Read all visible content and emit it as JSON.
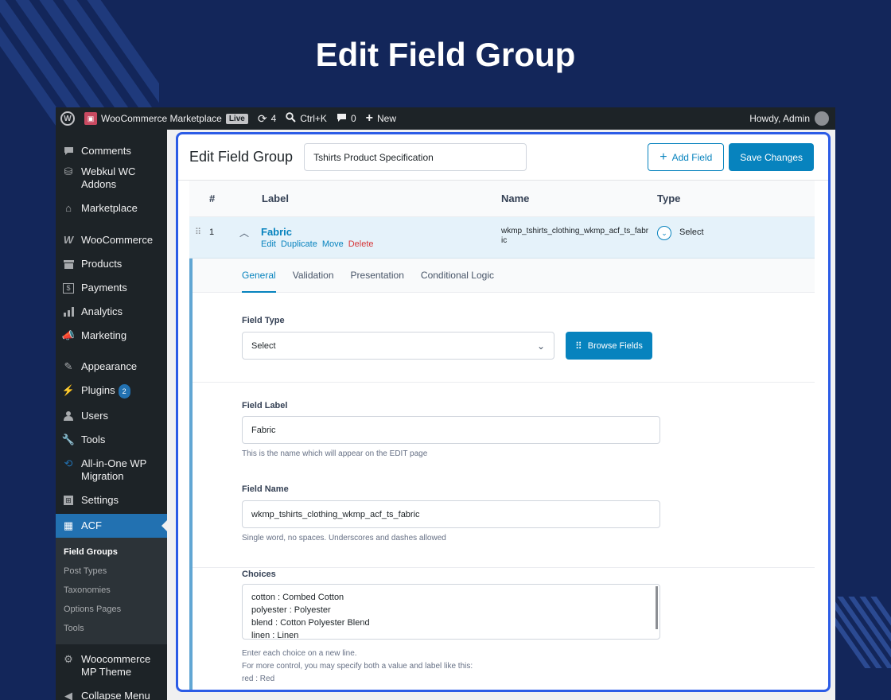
{
  "hero": {
    "title": "Edit Field Group"
  },
  "adminbar": {
    "site_name": "WooCommerce Marketplace",
    "live_badge": "Live",
    "updates_count": "4",
    "search_shortcut": "Ctrl+K",
    "comments_count": "0",
    "new_label": "New",
    "greeting": "Howdy, Admin"
  },
  "sidebar": {
    "items": [
      {
        "label": "Comments",
        "icon": "comment-icon"
      },
      {
        "label": "Webkul WC Addons",
        "icon": "webkul-icon"
      },
      {
        "label": "Marketplace",
        "icon": "store-icon"
      },
      {
        "label": "WooCommerce",
        "icon": "woocommerce-icon"
      },
      {
        "label": "Products",
        "icon": "archive-icon"
      },
      {
        "label": "Payments",
        "icon": "dollar-icon"
      },
      {
        "label": "Analytics",
        "icon": "chart-icon"
      },
      {
        "label": "Marketing",
        "icon": "megaphone-icon"
      },
      {
        "label": "Appearance",
        "icon": "brush-icon"
      },
      {
        "label": "Plugins",
        "icon": "plug-icon",
        "badge": "2"
      },
      {
        "label": "Users",
        "icon": "user-icon"
      },
      {
        "label": "Tools",
        "icon": "wrench-icon"
      },
      {
        "label": "All-in-One WP Migration",
        "icon": "migration-icon"
      },
      {
        "label": "Settings",
        "icon": "settings-icon"
      },
      {
        "label": "ACF",
        "icon": "acf-icon"
      }
    ],
    "submenu": [
      "Field Groups",
      "Post Types",
      "Taxonomies",
      "Options Pages",
      "Tools"
    ],
    "bottom_items": [
      {
        "label": "Woocommerce MP Theme",
        "icon": "gear-icon"
      },
      {
        "label": "Collapse Menu",
        "icon": "collapse-icon"
      }
    ]
  },
  "panel": {
    "title": "Edit Field Group",
    "group_name": "Tshirts Product Specification",
    "add_field": "Add Field",
    "save": "Save Changes"
  },
  "table": {
    "headers": {
      "order": "#",
      "label": "Label",
      "name": "Name",
      "type": "Type"
    },
    "row": {
      "order": "1",
      "label": "Fabric",
      "actions": {
        "edit": "Edit",
        "duplicate": "Duplicate",
        "move": "Move",
        "delete": "Delete"
      },
      "name_line1": "wkmp_tshirts_clothing_wkmp_acf_ts_fabr",
      "name_line2": "ic",
      "type": "Select"
    }
  },
  "tabs": [
    "General",
    "Validation",
    "Presentation",
    "Conditional Logic"
  ],
  "field_type": {
    "label": "Field Type",
    "value": "Select",
    "browse": "Browse Fields"
  },
  "field_label": {
    "label": "Field Label",
    "value": "Fabric",
    "help": "This is the name which will appear on the EDIT page"
  },
  "field_name": {
    "label": "Field Name",
    "value": "wkmp_tshirts_clothing_wkmp_acf_ts_fabric",
    "help": "Single word, no spaces. Underscores and dashes allowed"
  },
  "choices": {
    "label": "Choices",
    "lines": [
      "cotton : Combed Cotton",
      "polyester : Polyester",
      "blend : Cotton Polyester Blend",
      "linen : Linen"
    ],
    "help": [
      "Enter each choice on a new line.",
      "For more control, you may specify both a value and label like this:",
      "red : Red"
    ]
  },
  "colors": {
    "background": "#13265a",
    "accent": "#0783be",
    "panel_border": "#2c5ce6",
    "admin_dark": "#1d2327",
    "active_menu": "#2271b1"
  }
}
